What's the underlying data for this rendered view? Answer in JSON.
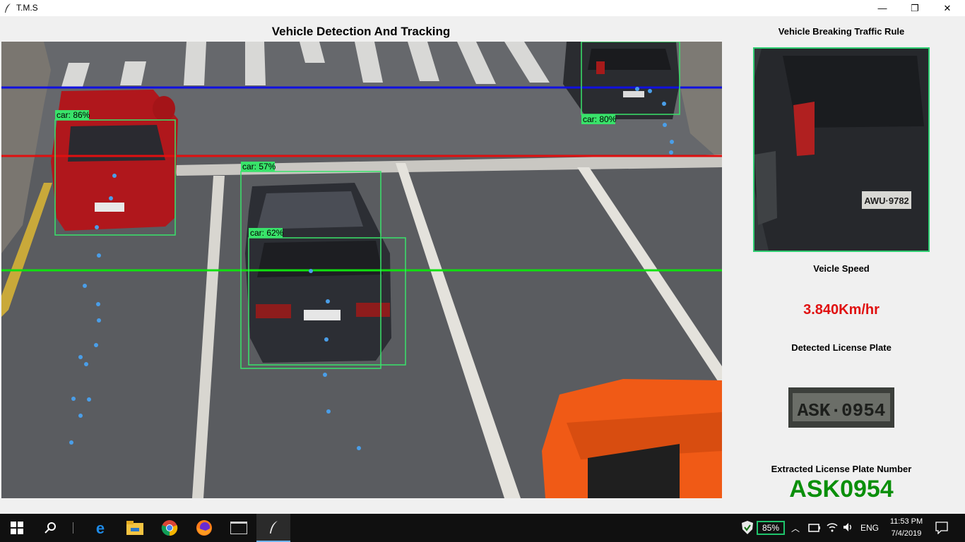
{
  "window": {
    "title": "T.M.S",
    "minimize_glyph": "—",
    "maximize_glyph": "❐",
    "close_glyph": "✕"
  },
  "video": {
    "title": "Vehicle Detection And Tracking",
    "detections": [
      {
        "label": "car: 86%"
      },
      {
        "label": "car: 80%"
      },
      {
        "label": "car: 57%"
      },
      {
        "label": "car: 62%"
      }
    ],
    "line_colors": {
      "top": "#1010e0",
      "middle": "#e01010",
      "bottom": "#10e010"
    },
    "box_color": "#39e36a",
    "tracking_dot_color": "#4a9ee8"
  },
  "side_panel": {
    "violation_heading": "Vehicle Breaking Traffic Rule",
    "violator_plate_text": "AWU·9782",
    "speed_heading": "Veicle Speed",
    "speed_value": "3.840Km/hr",
    "plate_heading": "Detected License Plate",
    "plate_crop_text": "ASK·0954",
    "extracted_heading": "Extracted License Plate Number",
    "extracted_value": "ASK0954"
  },
  "taskbar": {
    "icons": [
      "windows-start-icon",
      "search-icon",
      "edge-icon",
      "file-explorer-icon",
      "chrome-icon",
      "firefox-icon",
      "terminal-icon",
      "tms-app-icon"
    ],
    "battery_percent": "85%",
    "language": "ENG",
    "time": "11:53 PM",
    "date": "7/4/2019"
  },
  "colors": {
    "speed": "#e01010",
    "extracted_plate": "#0a8f0a",
    "box": "#39e36a"
  }
}
